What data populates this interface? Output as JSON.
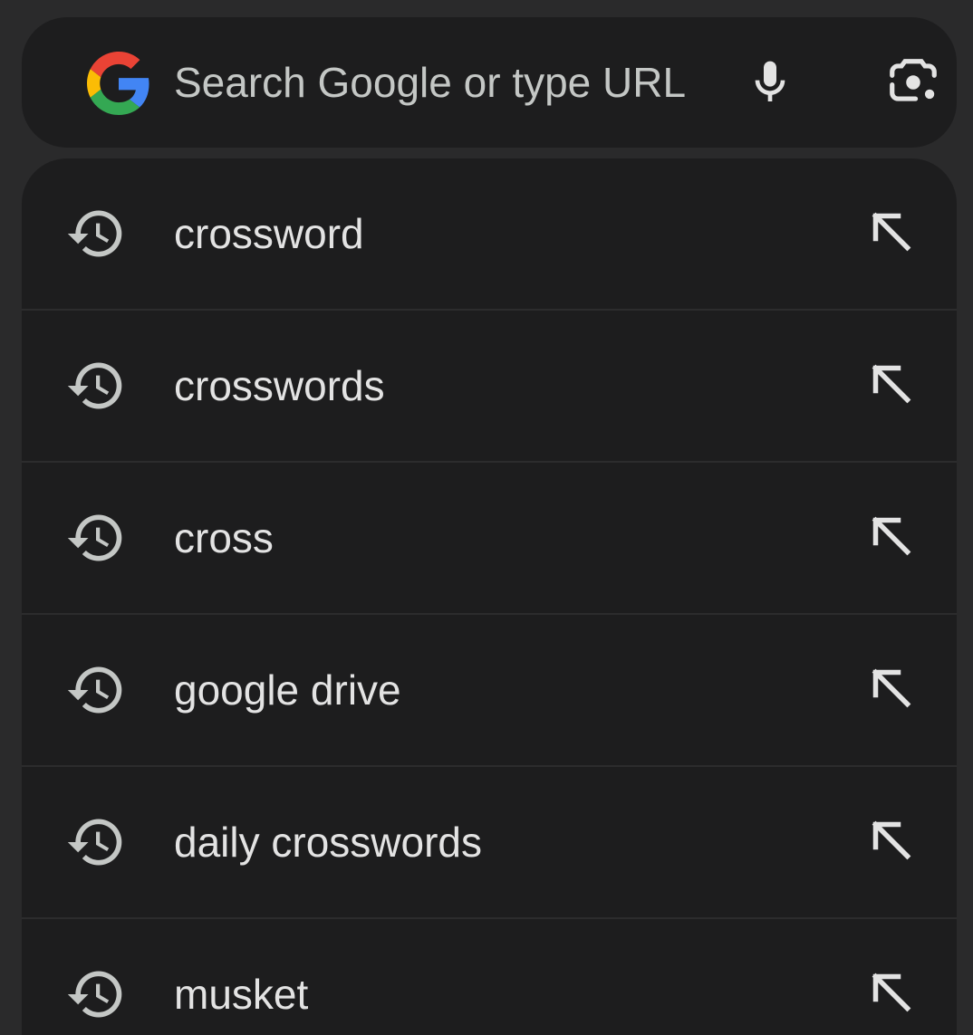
{
  "search": {
    "placeholder": "Search Google or type URL",
    "value": ""
  },
  "icons": {
    "logo": "google-g-logo",
    "mic": "mic-icon",
    "lens": "camera-lens-icon",
    "history": "history-icon",
    "refine": "arrow-up-left-icon"
  },
  "colors": {
    "background": "#2a2a2b",
    "surface": "#1d1d1e",
    "text": "#e3e3e3",
    "icon": "#c4c7c5",
    "google_blue": "#4285F4",
    "google_red": "#EA4335",
    "google_yellow": "#FBBC05",
    "google_green": "#34A853"
  },
  "suggestions": [
    {
      "label": "crossword"
    },
    {
      "label": "crosswords"
    },
    {
      "label": "cross"
    },
    {
      "label": "google drive"
    },
    {
      "label": "daily crosswords"
    },
    {
      "label": "musket"
    }
  ]
}
